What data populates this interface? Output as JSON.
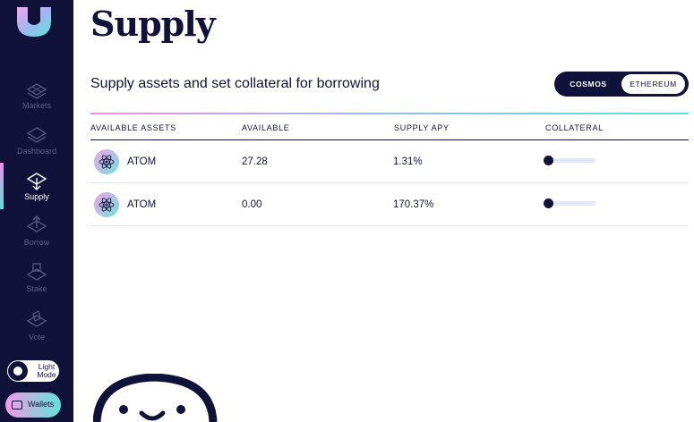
{
  "sidebar": {
    "items": [
      {
        "label": "Markets",
        "icon": "markets-icon"
      },
      {
        "label": "Dashboard",
        "icon": "dashboard-icon"
      },
      {
        "label": "Supply",
        "icon": "supply-icon",
        "active": true
      },
      {
        "label": "Borrow",
        "icon": "borrow-icon"
      },
      {
        "label": "Stake",
        "icon": "stake-icon"
      },
      {
        "label": "Vote",
        "icon": "vote-icon"
      }
    ],
    "light_mode_label": "Light Mode",
    "wallets_label": "Wallets"
  },
  "page": {
    "title": "Supply",
    "subtitle": "Supply assets and set collateral for borrowing"
  },
  "network_toggle": {
    "options": [
      "COSMOS",
      "ETHEREUM"
    ],
    "selected": "COSMOS"
  },
  "table": {
    "headers": [
      "AVAILABLE ASSETS",
      "AVAILABLE",
      "SUPPLY APY",
      "COLLATERAL"
    ],
    "rows": [
      {
        "asset": "ATOM",
        "available": "27.28",
        "apy": "1.31%",
        "collateral": 0
      },
      {
        "asset": "ATOM",
        "available": "0.00",
        "apy": "170.37%",
        "collateral": 0
      }
    ]
  },
  "colors": {
    "sidebar_bg": "#11123a",
    "accent_pink": "#f08fe6",
    "accent_teal": "#55e3d8"
  }
}
